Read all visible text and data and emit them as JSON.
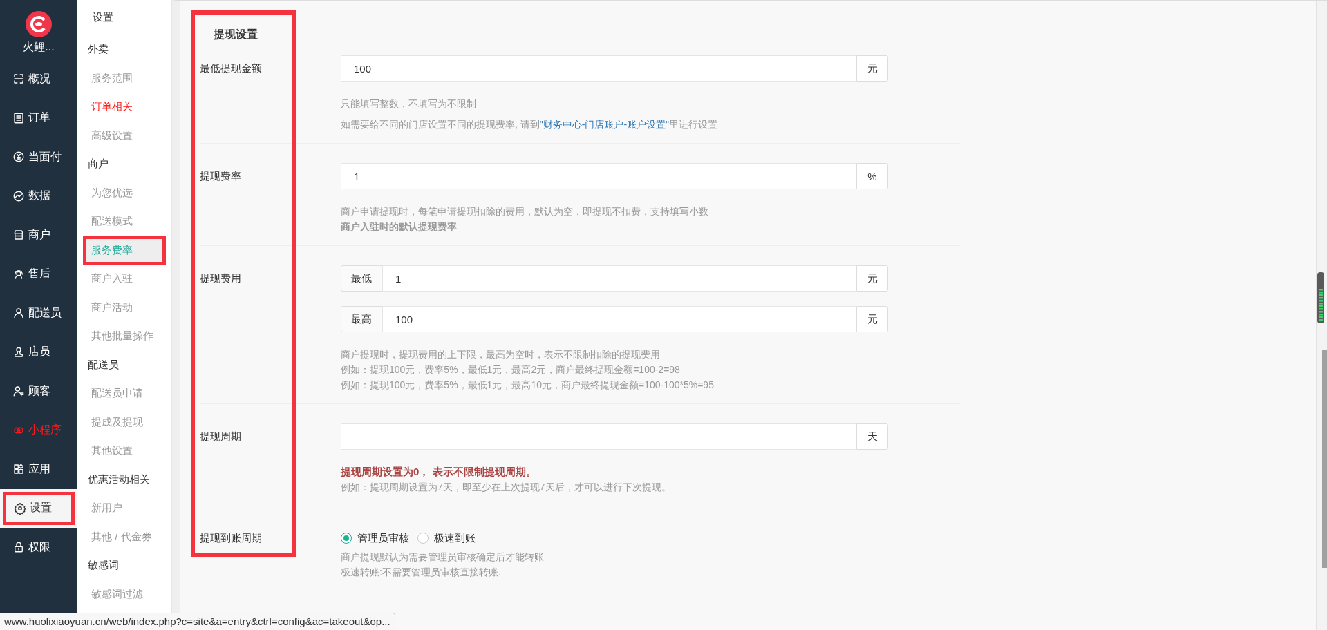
{
  "nav": {
    "brand": "火鲤...",
    "items": [
      {
        "label": "概况",
        "selected": false
      },
      {
        "label": "订单",
        "selected": false
      },
      {
        "label": "当面付",
        "selected": false
      },
      {
        "label": "数据",
        "selected": false
      },
      {
        "label": "商户",
        "selected": false
      },
      {
        "label": "售后",
        "selected": false
      },
      {
        "label": "配送员",
        "selected": false
      },
      {
        "label": "店员",
        "selected": false
      },
      {
        "label": "顾客",
        "selected": false
      },
      {
        "label": "小程序",
        "selected": false,
        "color": "#ff1a1a"
      },
      {
        "label": "应用",
        "selected": false
      },
      {
        "label": "设置",
        "selected": true,
        "annotated": true
      },
      {
        "label": "权限",
        "selected": false
      }
    ]
  },
  "subnav": {
    "title": "设置",
    "items": [
      {
        "kind": "group",
        "label": "外卖",
        "selected": false
      },
      {
        "kind": "item",
        "label": "服务范围",
        "selected": false
      },
      {
        "kind": "item",
        "label": "订单相关",
        "selected": false,
        "color": "#ff1a1a"
      },
      {
        "kind": "item",
        "label": "高级设置",
        "selected": false
      },
      {
        "kind": "group",
        "label": "商户",
        "selected": false
      },
      {
        "kind": "item",
        "label": "为您优选",
        "selected": false
      },
      {
        "kind": "item",
        "label": "配送模式",
        "selected": false
      },
      {
        "kind": "item",
        "label": "服务费率",
        "selected": true,
        "annotated": true
      },
      {
        "kind": "item",
        "label": "商户入驻",
        "selected": false
      },
      {
        "kind": "item",
        "label": "商户活动",
        "selected": false
      },
      {
        "kind": "item",
        "label": "其他批量操作",
        "selected": false
      },
      {
        "kind": "group",
        "label": "配送员",
        "selected": false
      },
      {
        "kind": "item",
        "label": "配送员申请",
        "selected": false
      },
      {
        "kind": "item",
        "label": "提成及提现",
        "selected": false
      },
      {
        "kind": "item",
        "label": "其他设置",
        "selected": false
      },
      {
        "kind": "group",
        "label": "优惠活动相关",
        "selected": false
      },
      {
        "kind": "item",
        "label": "新用户",
        "selected": false
      },
      {
        "kind": "item",
        "label": "其他 / 代金券",
        "selected": false
      },
      {
        "kind": "group",
        "label": "敏感词",
        "selected": false
      },
      {
        "kind": "item",
        "label": "敏感词过滤",
        "selected": false
      }
    ]
  },
  "form": {
    "title": "提现设置",
    "annotated": true,
    "rows": [
      {
        "kind": "input",
        "label": "最低提现金额",
        "fields": [
          {
            "value": "100",
            "suffix": "元"
          }
        ],
        "hints": [
          {
            "kind": "para",
            "text": "只能填写整数，不填写为不限制"
          },
          {
            "kind": "link",
            "before": "如需要给不同的门店设置不同的提现费率, 请到",
            "link": "\"财务中心-门店账户-账户设置\"",
            "after": "里进行设置"
          }
        ]
      },
      {
        "kind": "input",
        "label": "提现费率",
        "fields": [
          {
            "value": "1",
            "suffix": "%"
          }
        ],
        "hints": [
          {
            "kind": "line",
            "text": "商户申请提现时，每笔申请提现扣除的费用，默认为空，即提现不扣费，支持填写小数"
          },
          {
            "kind": "bold",
            "text": "商户入驻时的默认提现费率"
          }
        ]
      },
      {
        "kind": "input",
        "label": "提现费用",
        "fields": [
          {
            "prefix": "最低",
            "value": "1",
            "suffix": "元"
          },
          {
            "prefix": "最高",
            "value": "100",
            "suffix": "元"
          }
        ],
        "hints": [
          {
            "kind": "line",
            "text": "商户提现时，提现费用的上下限，最高为空时，表示不限制扣除的提现费用"
          },
          {
            "kind": "line",
            "text": "例如：提现100元，费率5%，最低1元，最高2元，商户最终提现金额=100-2=98"
          },
          {
            "kind": "line",
            "text": "例如：提现100元，费率5%，最低1元，最高10元，商户最终提现金额=100-100*5%=95"
          }
        ]
      },
      {
        "kind": "input",
        "label": "提现周期",
        "fields": [
          {
            "suffix": "天"
          }
        ],
        "hints": [
          {
            "kind": "warning",
            "text": "提现周期设置为0， 表示不限制提现周期。"
          },
          {
            "kind": "line",
            "text": "例如：提现周期设置为7天，即至少在上次提现7天后，才可以进行下次提现。"
          }
        ]
      },
      {
        "kind": "radio",
        "label": "提现到账周期",
        "options": [
          {
            "label": "管理员审核",
            "selected": true
          },
          {
            "label": "极速到账",
            "selected": false
          }
        ],
        "hints": [
          {
            "kind": "line",
            "text": "商户提现默认为需要管理员审核确定后才能转账"
          },
          {
            "kind": "line",
            "text": "极速转账:不需要管理员审核直接转账."
          }
        ]
      }
    ]
  },
  "status_bar": {
    "url": "www.huolixiaoyuan.cn/web/index.php?c=site&a=entry&ctrl=config&ac=takeout&op..."
  }
}
